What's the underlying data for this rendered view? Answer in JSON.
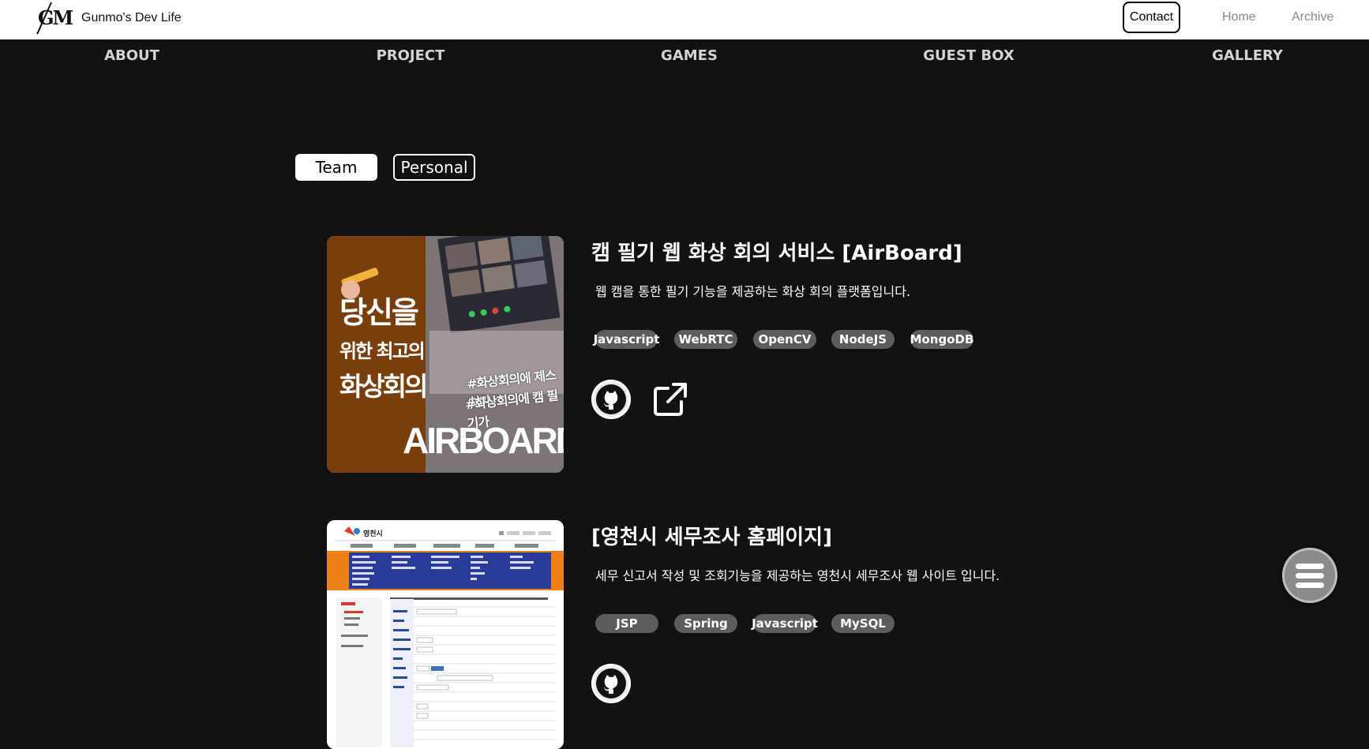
{
  "header": {
    "logo_text": "GM",
    "site_title": "Gunmo's Dev Life",
    "contact_label": "Contact",
    "home_label": "Home",
    "archive_label": "Archive"
  },
  "nav": {
    "items": [
      "ABOUT",
      "PROJECT",
      "GAMES",
      "GUEST BOX",
      "GALLERY"
    ]
  },
  "filters": {
    "team_label": "Team",
    "personal_label": "Personal",
    "selected": "Team"
  },
  "projects": [
    {
      "title": "캠 필기 웹 화상 회의 서비스 [AirBoard]",
      "description": "웹 캠을 통한 필기 기능을 제공하는 화상 회의 플랫폼입니다.",
      "tags": [
        "Javascript",
        "WebRTC",
        "OpenCV",
        "NodeJS",
        "MongoDB"
      ],
      "thumbnail": {
        "line1": "당신을",
        "line2": "위한 최고의",
        "line3": "화상회의",
        "hashtag1": "#화상회의에 제스처가",
        "hashtag2": "#화상회의에 캠 필기가",
        "brand": "AIRBOARD"
      },
      "links": [
        "github-icon",
        "external-link-icon"
      ]
    },
    {
      "title": "[영천시 세무조사 홈페이지]",
      "description": "세무 신고서 작성 및 조회기능을 제공하는 영천시 세무조사 웹 사이트 입니다.",
      "tags": [
        "JSP",
        "Spring",
        "Javascript",
        "MySQL"
      ],
      "thumbnail": {
        "logo": "영천시"
      },
      "links": [
        "github-icon"
      ]
    }
  ],
  "colors": {
    "background": "#121212",
    "tag_bg": "#5d5d5d",
    "thumb_brown": "#7a3d0c",
    "site_orange": "#f07f1a",
    "site_blue": "#2a3b9a"
  },
  "fab_icon": "hamburger-menu-icon"
}
